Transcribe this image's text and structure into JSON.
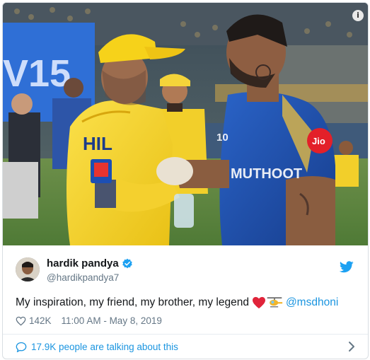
{
  "photo": {
    "alt": "",
    "info_glyph": "i",
    "backdrop_text": "V15",
    "jersey_left": "HIL",
    "jersey_right_sponsor": "Jio",
    "jersey_right_text": "MUTHOOT",
    "jersey_right_num": "10"
  },
  "tweet": {
    "display_name": "hardik pandya",
    "handle": "@hardikpandya7",
    "verified": true,
    "text_before": "My inspiration, my friend, my brother, my legend",
    "emojis": [
      "red-heart-icon",
      "helicopter-icon"
    ],
    "mention": "@msdhoni",
    "likes": "142K",
    "timestamp": "11:00 AM - May 8, 2019",
    "footer": "17.9K people are talking about this"
  },
  "colors": {
    "link": "#1b95e0",
    "muted": "#657786",
    "verified": "#1da1f2",
    "csk_yellow": "#f7d11e",
    "mi_blue": "#1f4fa8"
  }
}
